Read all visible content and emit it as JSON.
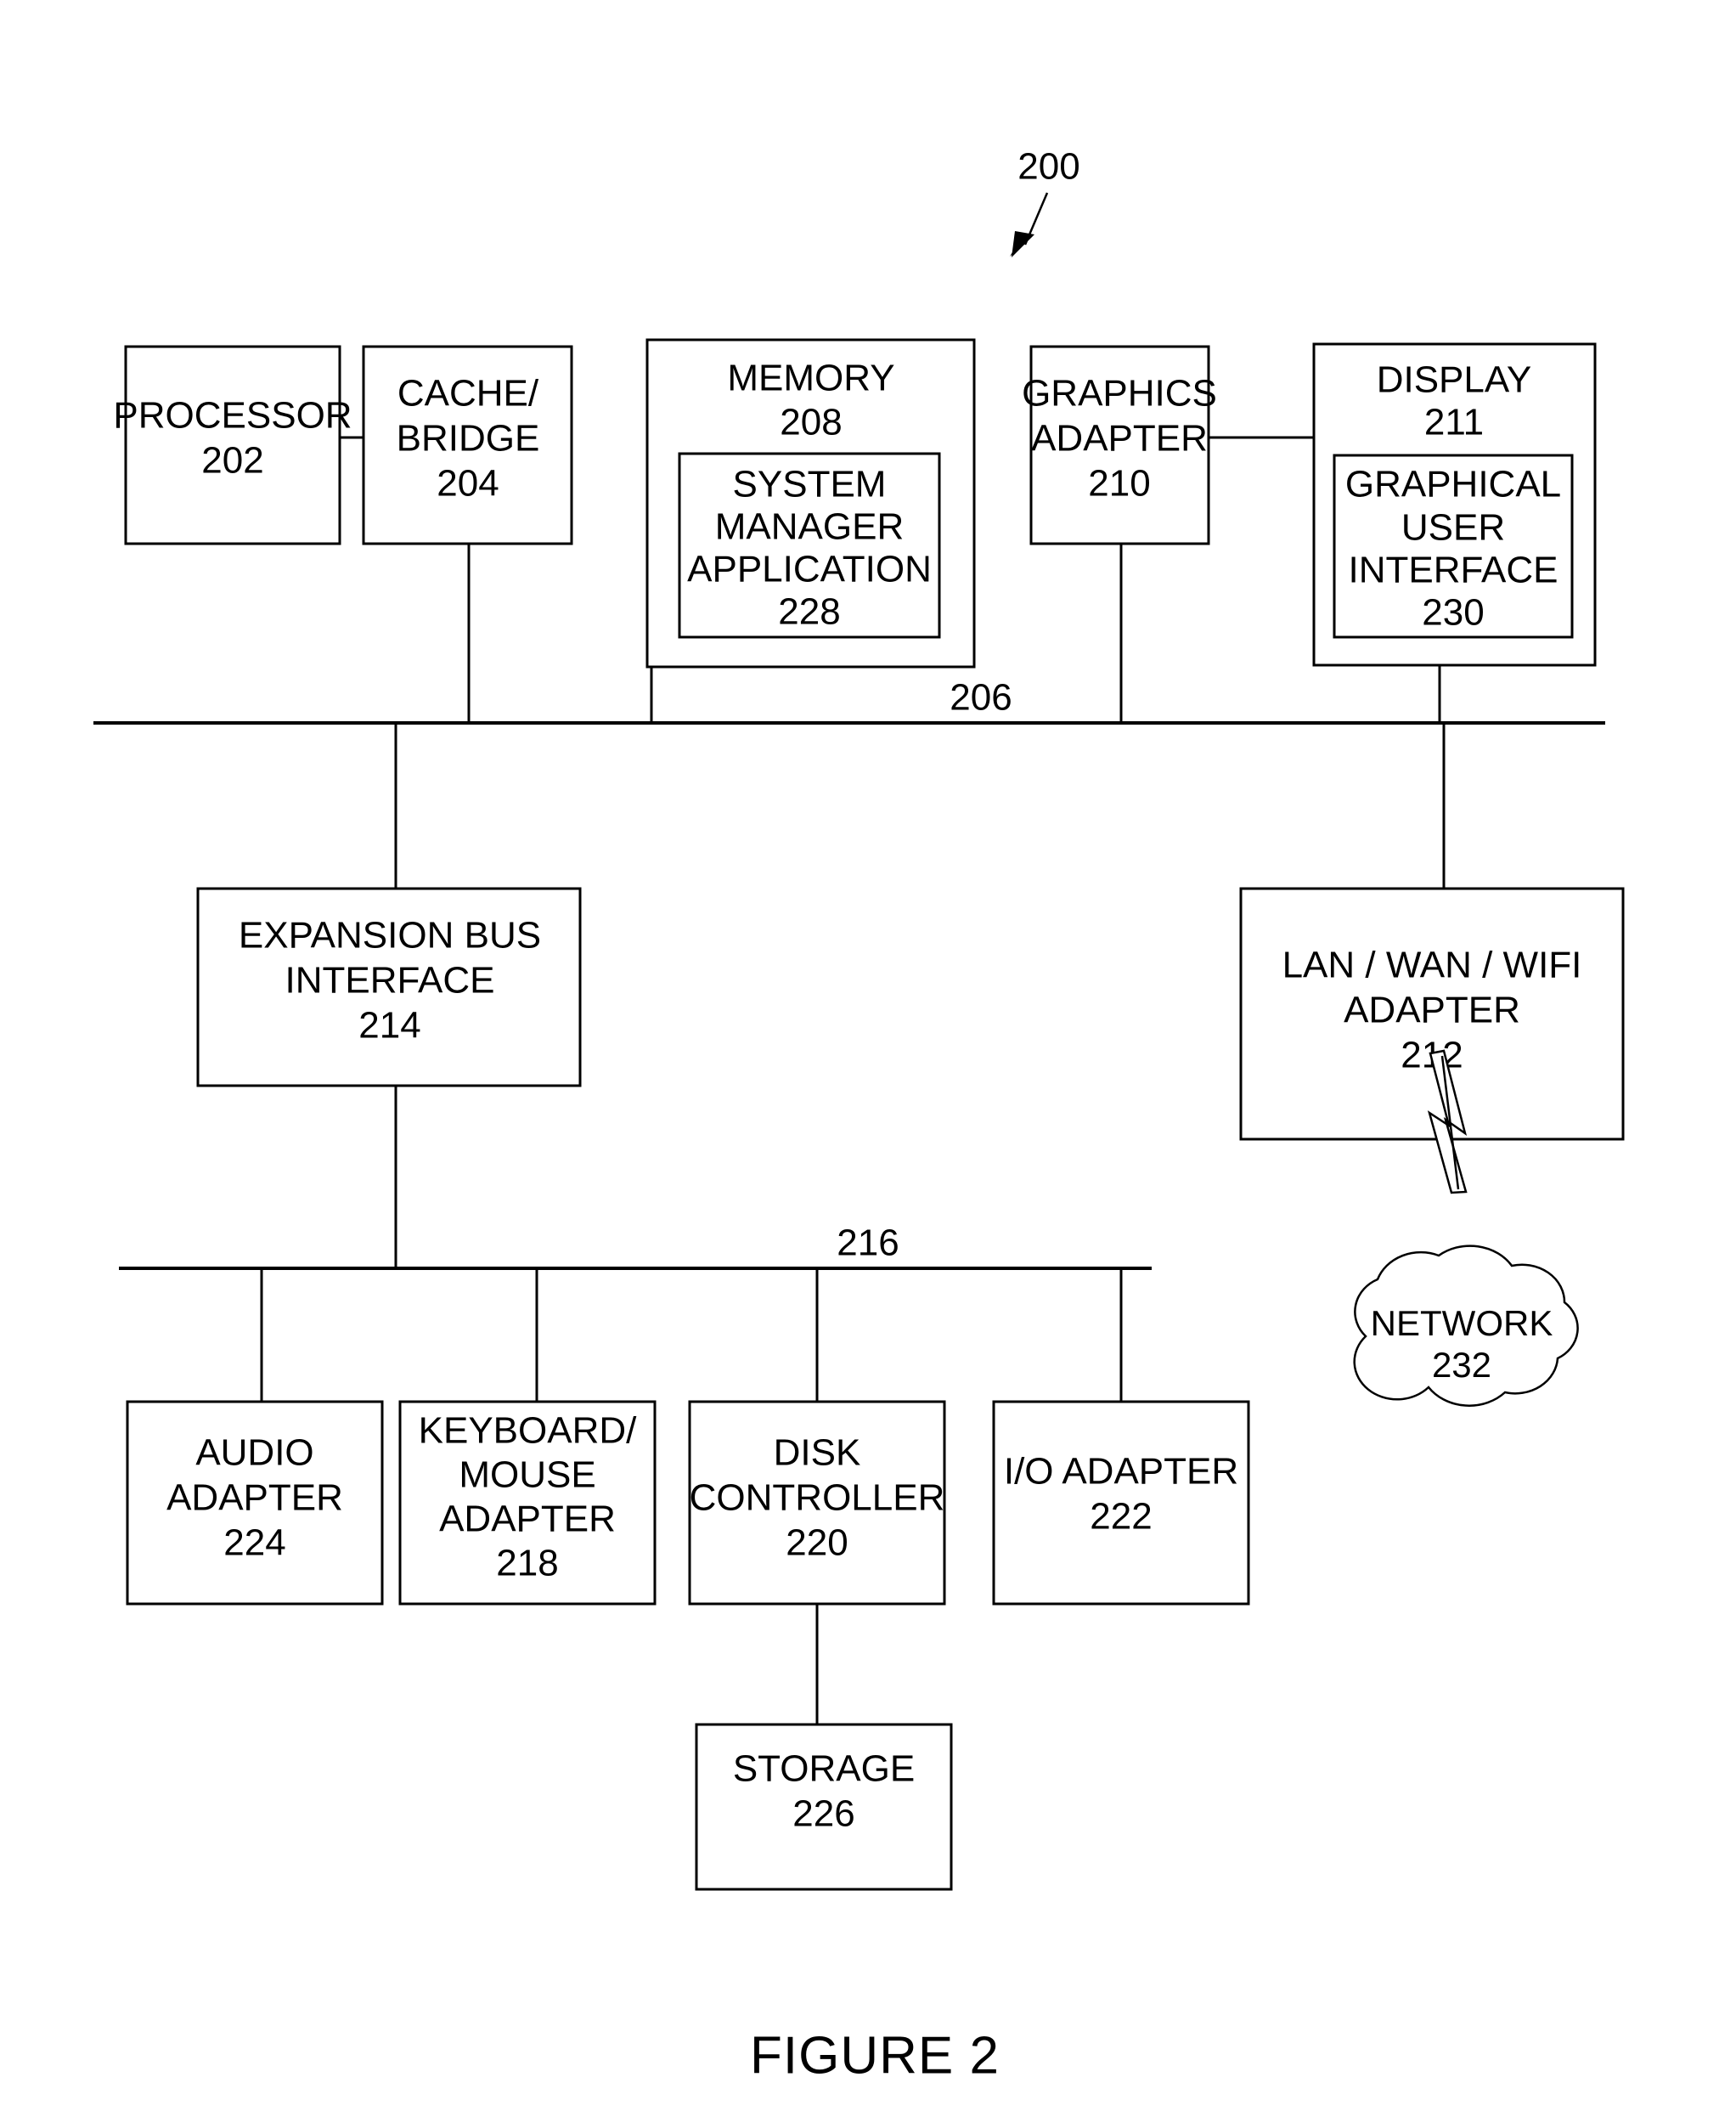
{
  "figure": {
    "caption": "FIGURE 2",
    "system_reference": "200"
  },
  "blocks": {
    "processor": {
      "title": "PROCESSOR",
      "ref": "202"
    },
    "cache_bridge": {
      "line1": "CACHE/",
      "line2": "BRIDGE",
      "ref": "204"
    },
    "memory": {
      "title": "MEMORY",
      "ref": "208"
    },
    "system_manager": {
      "line1": "SYSTEM",
      "line2": "MANAGER",
      "line3": "APPLICATION",
      "ref": "228"
    },
    "graphics_adapter": {
      "line1": "GRAPHICS",
      "line2": "ADAPTER",
      "ref": "210"
    },
    "display": {
      "title": "DISPLAY",
      "ref": "211"
    },
    "gui": {
      "line1": "GRAPHICAL",
      "line2": "USER",
      "line3": "INTERFACE",
      "ref": "230"
    },
    "expansion_bus_interface": {
      "line1": "EXPANSION BUS",
      "line2": "INTERFACE",
      "ref": "214"
    },
    "lan_wan_wifi_adapter": {
      "line1": "LAN / WAN / WIFI",
      "line2": "ADAPTER",
      "ref": "212"
    },
    "network": {
      "title": "NETWORK",
      "ref": "232"
    },
    "audio_adapter": {
      "line1": "AUDIO",
      "line2": "ADAPTER",
      "ref": "224"
    },
    "keyboard_mouse_adapter": {
      "line1": "KEYBOARD/",
      "line2": "MOUSE",
      "line3": "ADAPTER",
      "ref": "218"
    },
    "disk_controller": {
      "line1": "DISK",
      "line2": "CONTROLLER",
      "ref": "220"
    },
    "io_adapter": {
      "title": "I/O ADAPTER",
      "ref": "222"
    },
    "storage": {
      "title": "STORAGE",
      "ref": "226"
    }
  },
  "buses": {
    "system_bus": {
      "ref": "206"
    },
    "expansion_bus": {
      "ref": "216"
    }
  },
  "colors": {
    "stroke": "#000000",
    "fill": "#ffffff",
    "text": "#000000"
  }
}
